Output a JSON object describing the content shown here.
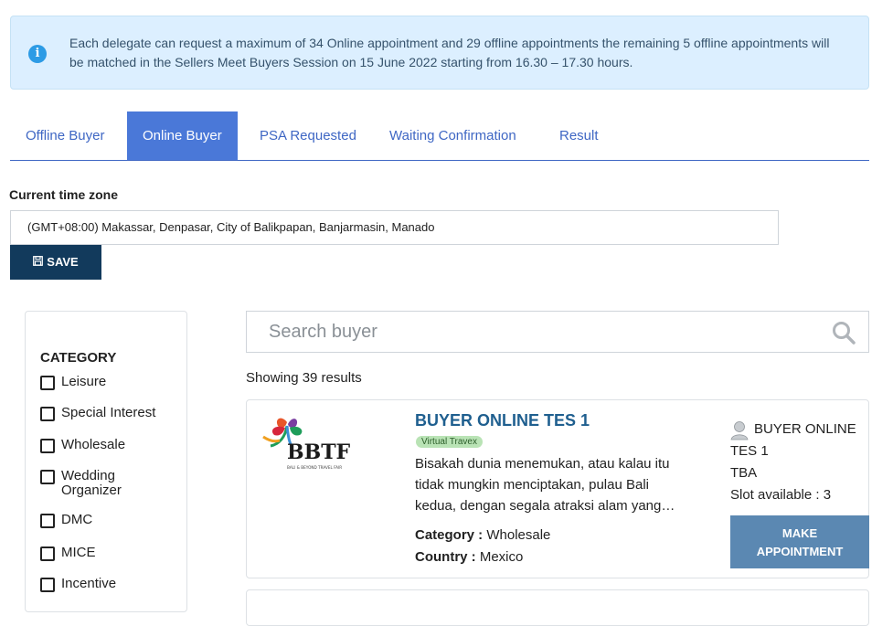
{
  "notice": {
    "icon": "info-icon",
    "text": "Each delegate can request a maximum of 34 Online appointment and 29 offline appointments the remaining 5 offline appointments will be matched in the Sellers Meet Buyers Session on 15 June 2022 starting from 16.30 – 17.30 hours."
  },
  "tabs": [
    {
      "label": "Offline Buyer",
      "active": false
    },
    {
      "label": "Online Buyer",
      "active": true
    },
    {
      "label": "PSA Requested",
      "active": false
    },
    {
      "label": "Waiting Confirmation",
      "active": false
    },
    {
      "label": "Result",
      "active": false
    }
  ],
  "timezone": {
    "label": "Current time zone",
    "value": "(GMT+08:00) Makassar, Denpasar, City of Balikpapan, Banjarmasin, Manado",
    "save_label": "SAVE",
    "save_icon": "floppy-disk-icon"
  },
  "category": {
    "title": "CATEGORY",
    "items": [
      "Leisure",
      "Special Interest",
      "Wholesale",
      "Wedding Organizer",
      "DMC",
      "MICE",
      "Incentive"
    ]
  },
  "search": {
    "placeholder": "Search buyer",
    "icon": "search-icon"
  },
  "results_text": "Showing 39 results",
  "buyers": [
    {
      "logo": "BBTF",
      "logo_sub": "BALI & BEYOND TRAVEL FAIR",
      "name": "BUYER ONLINE TES 1",
      "tag": "Virtual Travex",
      "description": "Bisakah dunia menemukan, atau kalau itu tidak mungkin menciptakan, pulau Bali kedua, dengan segala atraksi alam yang…",
      "category_label": "Category :",
      "category": "Wholesale",
      "country_label": "Country :",
      "country": "Mexico",
      "contact_name": "BUYER ONLINE TES 1",
      "contact_sub": "TBA",
      "slot_text": "Slot available : 3",
      "button_line1": "MAKE",
      "button_line2": "APPOINTMENT"
    }
  ],
  "colors": {
    "accent": "#4a78d8",
    "save_bg": "#123a5c",
    "appointment_bg": "#5b88b2",
    "notice_bg": "#dcefff"
  }
}
